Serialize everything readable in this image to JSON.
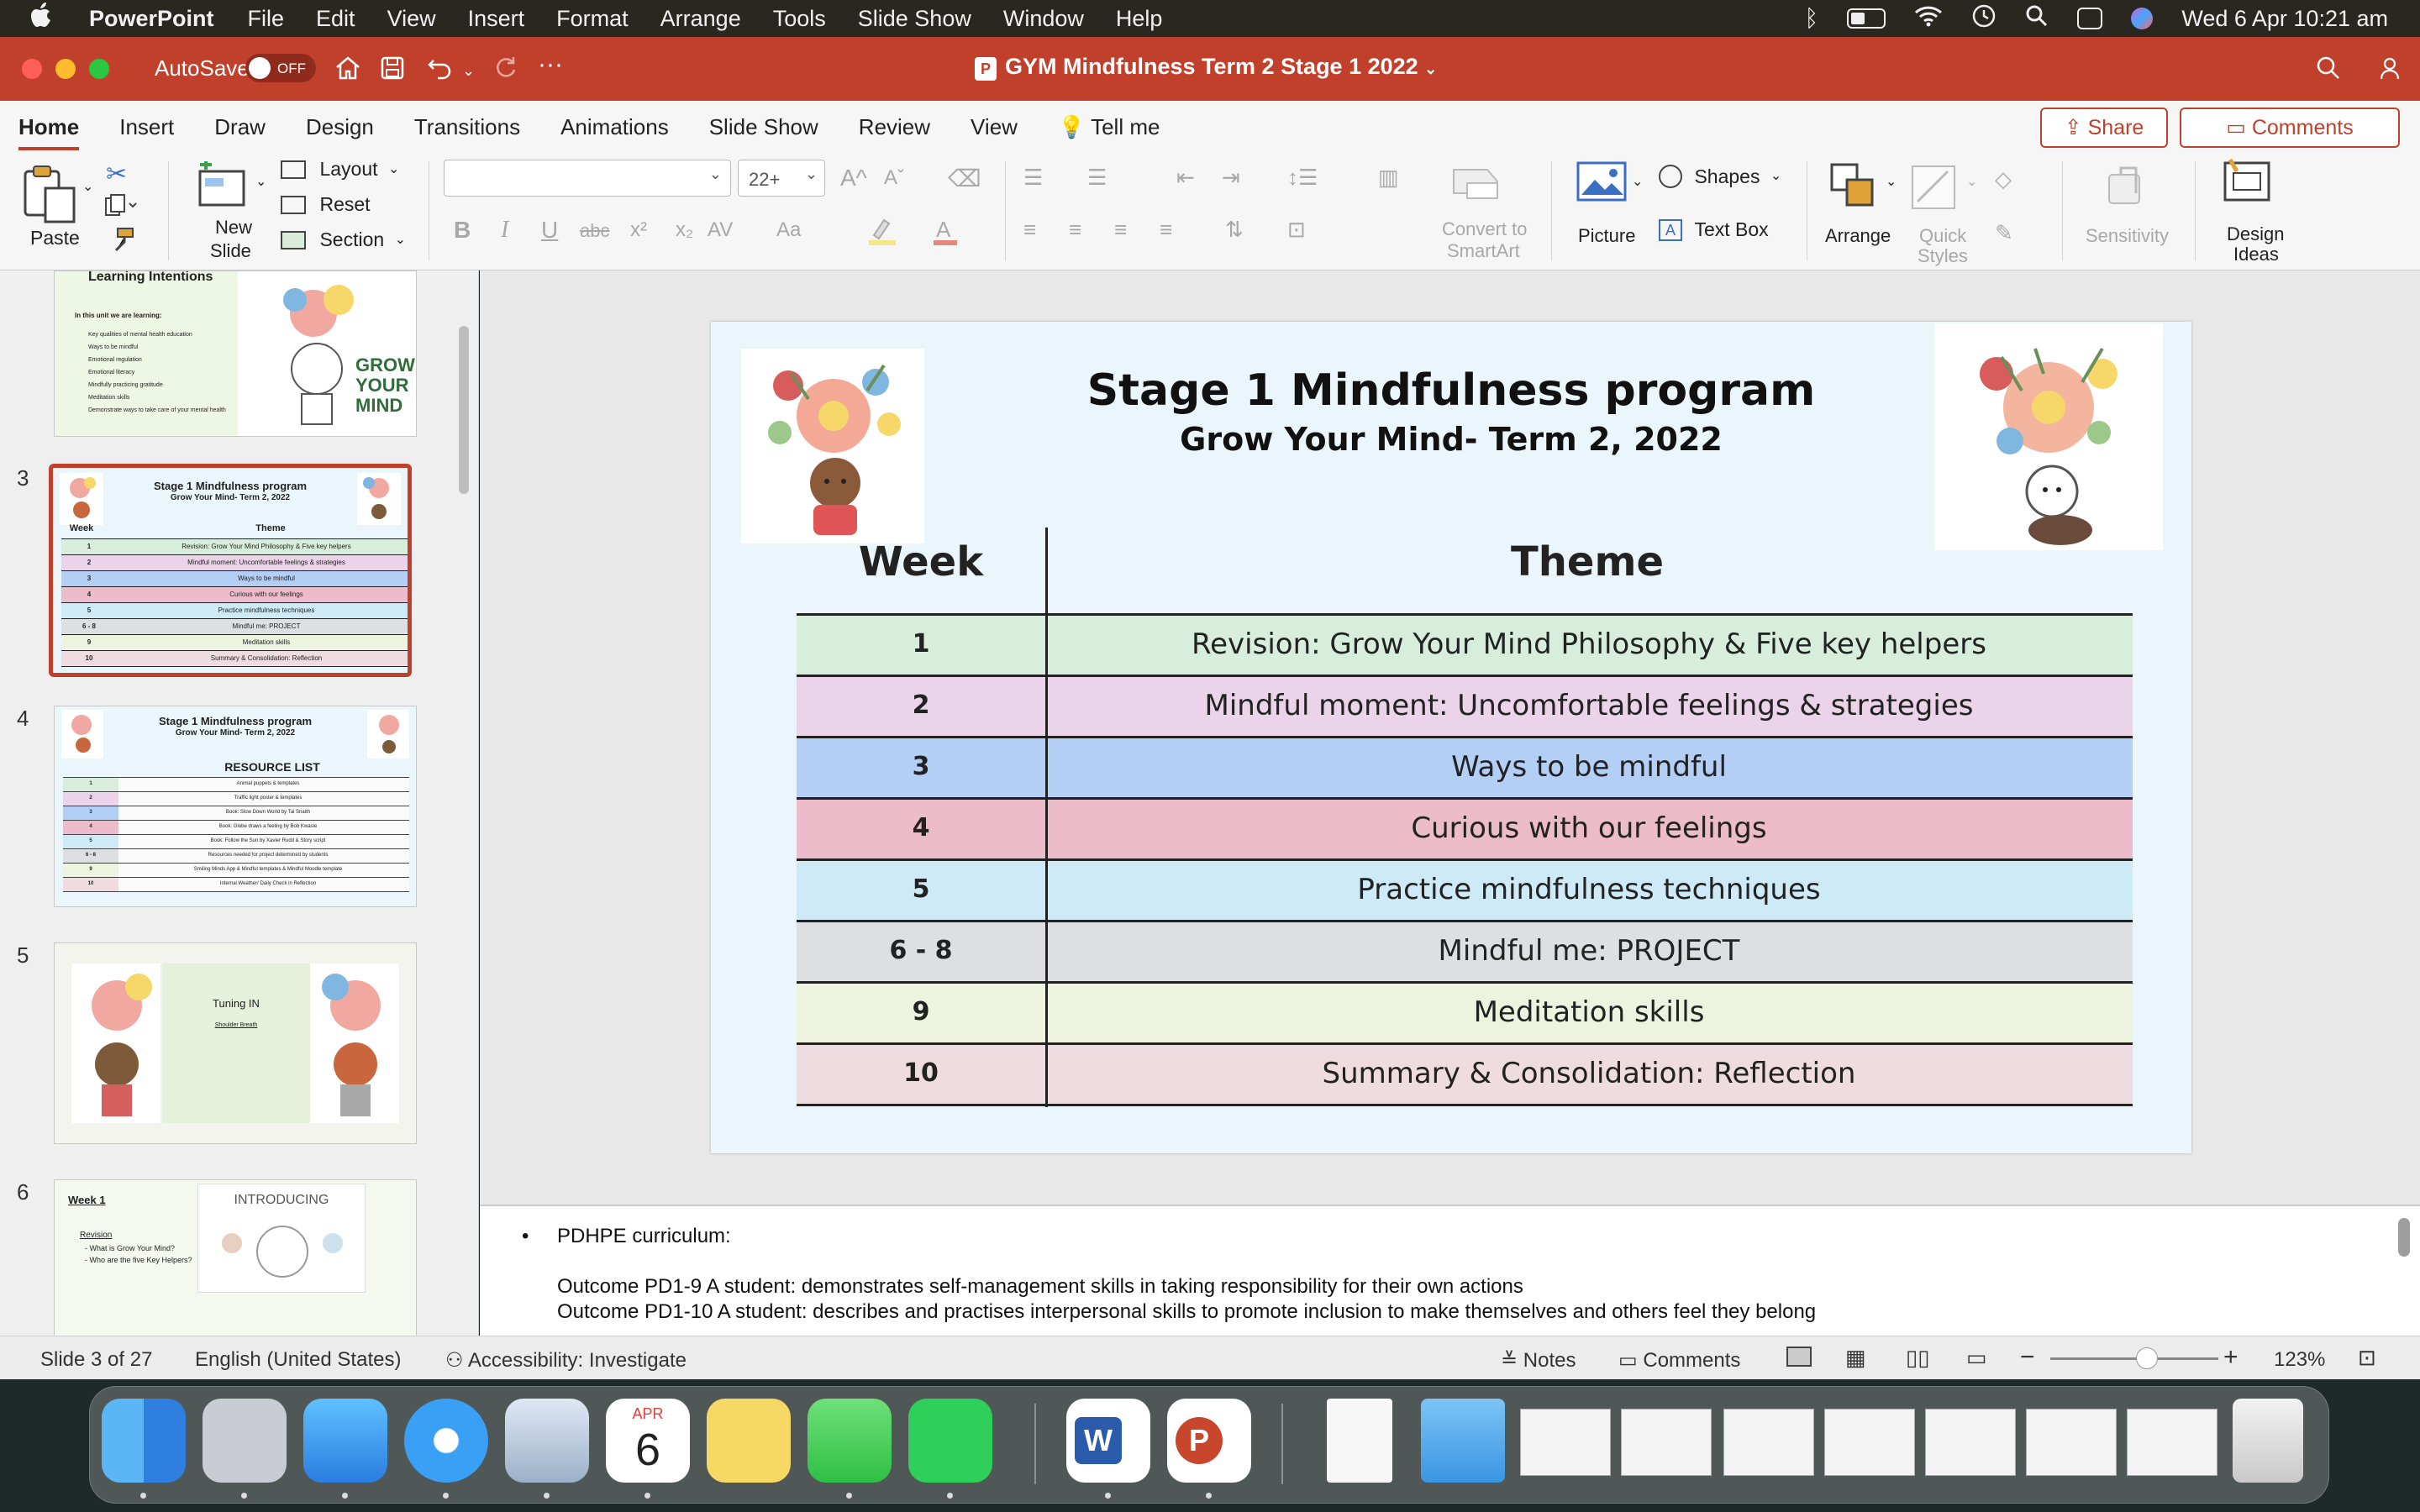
{
  "menubar": {
    "app": "PowerPoint",
    "items": [
      "File",
      "Edit",
      "View",
      "Insert",
      "Format",
      "Arrange",
      "Tools",
      "Slide Show",
      "Window",
      "Help"
    ],
    "clock": "Wed 6 Apr  10:21 am"
  },
  "titlebar": {
    "autosave": "AutoSave",
    "toggle": "OFF",
    "doc_title": "GYM Mindfulness Term 2 Stage 1 2022",
    "file_badge": "P"
  },
  "ribbon": {
    "tabs": [
      "Home",
      "Insert",
      "Draw",
      "Design",
      "Transitions",
      "Animations",
      "Slide Show",
      "Review",
      "View"
    ],
    "tell_me": "Tell me",
    "share": "Share",
    "comments": "Comments",
    "paste": "Paste",
    "new_slide_1": "New",
    "new_slide_2": "Slide",
    "layout": "Layout",
    "reset": "Reset",
    "section": "Section",
    "font_name": "",
    "font_size": "22+",
    "bold_glyph": "B",
    "italic_glyph": "I",
    "underline_glyph": "U",
    "strike_glyph": "abc",
    "super_glyph": "x²",
    "sub_glyph": "x₂",
    "spacing_glyph": "AV",
    "case_glyph": "Aa",
    "font_grow_glyph": "A^",
    "font_shrink_glyph": "Aˇ",
    "color_glyph": "A",
    "smartart_1": "Convert to",
    "smartart_2": "SmartArt",
    "picture": "Picture",
    "shapes": "Shapes",
    "text_box": "Text Box",
    "arrange": "Arrange",
    "quick_styles_1": "Quick",
    "quick_styles_2": "Styles",
    "sensitivity": "Sensitivity",
    "design_ideas_1": "Design",
    "design_ideas_2": "Ideas"
  },
  "panel": {
    "thumbs": [
      {
        "num": "3",
        "title": "Stage 1 Mindfulness program",
        "sub": "Grow Your Mind- Term 2, 2022"
      },
      {
        "num": "4",
        "title": "Stage 1 Mindfulness program",
        "sub": "Grow Your Mind- Term 2, 2022",
        "heading": "RESOURCE LIST"
      },
      {
        "num": "5",
        "title": "Tuning IN"
      },
      {
        "num": "6",
        "title": "Week 1",
        "heading": "INTRODUCING"
      }
    ],
    "thumb2_title": "Learning Intentions",
    "thumb2_lead": "In this unit we are learning:",
    "thumb2_items": [
      "Key qualities of mental health education",
      "Ways to be mindful",
      "Emotional regulation",
      "Emotional literacy",
      "Mindfully practicing gratitude",
      "Meditation skills",
      "Demonstrate ways to take care of your mental health"
    ],
    "thumb2_art": "GROW YOUR MIND",
    "thumb3_week": "Week",
    "thumb3_theme": "Theme",
    "thumb4_rows": [
      "Animal puppets & templates",
      "Traffic light poster & templates",
      "Book: Slow Down World by Tai Snaith",
      "Book: Globe draws a feeling by Bob Kwasle",
      "Book: Follow the Sun by Xavier Rudd & Story script",
      "Resources needed for project determined by students",
      "Smiling Minds App & Mindful templates & Mindful Moodle template",
      "Internal Weather/ Daily Check in Reflection"
    ],
    "thumb4_weeks": [
      "1",
      "2",
      "3",
      "4",
      "5",
      "6 - 8",
      "9",
      "10"
    ],
    "thumb5_sub": "Shoulder Breath",
    "thumb6_items": [
      "Revision",
      "- What is Grow Your Mind?",
      "- Who are the five Key Helpers?"
    ]
  },
  "slide": {
    "title": "Stage 1 Mindfulness program",
    "subtitle": "Grow Your Mind- Term 2, 2022",
    "col_week": "Week",
    "col_theme": "Theme",
    "rows": [
      {
        "week": "1",
        "theme": "Revision: Grow Your Mind Philosophy & Five key helpers",
        "color": "#d7eedc"
      },
      {
        "week": "2",
        "theme": "Mindful moment: Uncomfortable feelings & strategies",
        "color": "#ebd3ea"
      },
      {
        "week": "3",
        "theme": "Ways to be mindful",
        "color": "#b3cff5"
      },
      {
        "week": "4",
        "theme": "Curious with our feelings",
        "color": "#ecbccb"
      },
      {
        "week": "5",
        "theme": "Practice mindfulness techniques",
        "color": "#cfeaf7"
      },
      {
        "week": "6 - 8",
        "theme": "Mindful me: PROJECT",
        "color": "#dddfe2"
      },
      {
        "week": "9",
        "theme": "Meditation skills",
        "color": "#eef3df"
      },
      {
        "week": "10",
        "theme": "Summary & Consolidation: Reflection",
        "color": "#efdce0"
      }
    ]
  },
  "notes": {
    "line1": "PDHPE curriculum:",
    "line2": "Outcome PD1-9 A student: demonstrates self-management skills in taking responsibility for their own actions",
    "line3": "Outcome PD1-10 A student: describes and practises interpersonal skills to promote inclusion to make themselves and others feel they belong"
  },
  "status": {
    "slide": "Slide 3 of 27",
    "language": "English (United States)",
    "accessibility": "Accessibility: Investigate",
    "notes": "Notes",
    "comments": "Comments",
    "zoom": "123%"
  },
  "dock": {
    "calendar_month": "APR",
    "calendar_day": "6"
  },
  "colors": {
    "accent": "#c1402b",
    "slide_bg": "#eaf6fc"
  }
}
